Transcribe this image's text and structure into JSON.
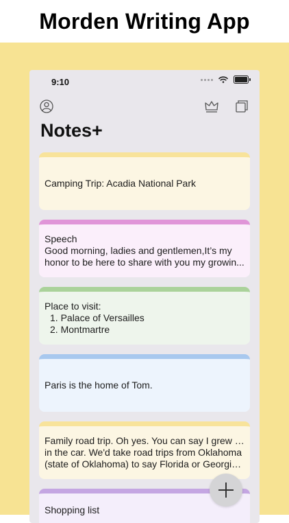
{
  "headline": "Morden Writing App",
  "status_bar": {
    "time": "9:10"
  },
  "header": {
    "title": "Notes+"
  },
  "notes": [
    {
      "color": "#f8e39a",
      "bg": "#fcf6e3",
      "lines": [
        "Camping Trip: Acadia National Park"
      ]
    },
    {
      "color": "#e095d8",
      "bg": "#fbeffb",
      "lines": [
        "Speech",
        "Good morning, ladies and gentlemen,It’s my",
        "honor to be here to share with you my growin..."
      ]
    },
    {
      "color": "#aad29a",
      "bg": "#eef5ec",
      "lines": [
        "Place to visit:"
      ],
      "list": [
        "1. Palace of Versailles",
        "2. Montmartre"
      ]
    },
    {
      "color": "#a8c8ee",
      "bg": "#edf4fd",
      "lines": [
        "Paris is the home of Tom."
      ]
    },
    {
      "color": "#f8e39a",
      "bg": "#fcf6e3",
      "lines": [
        "Family road trip. Oh yes. You can say I grew up",
        "in the car. We'd take road trips from Oklahoma",
        "(state of Oklahoma) to say Florida or Georgia,..."
      ]
    },
    {
      "color": "#c4a6e2",
      "bg": "#f4eefb",
      "lines": [
        "Shopping list"
      ]
    }
  ],
  "icons": {
    "profile": "person-circle-icon",
    "premium": "crown-icon",
    "multi": "copy-icon",
    "add": "plus-icon"
  }
}
